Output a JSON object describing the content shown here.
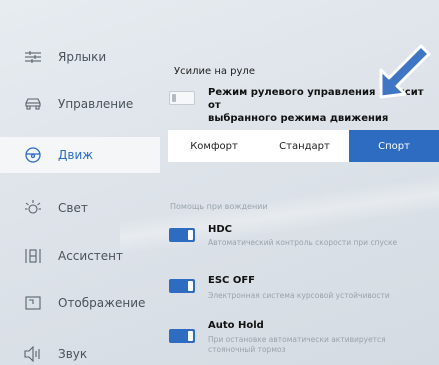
{
  "sidebar": {
    "items": [
      {
        "label": "Ярлыки",
        "icon": "shortcuts-icon"
      },
      {
        "label": "Управление",
        "icon": "car-icon"
      },
      {
        "label": "Движ",
        "icon": "steering-wheel-icon",
        "active": true
      },
      {
        "label": "Свет",
        "icon": "light-icon"
      },
      {
        "label": "Ассистент",
        "icon": "assistant-icon"
      },
      {
        "label": "Отображение",
        "icon": "display-icon"
      },
      {
        "label": "Звук",
        "icon": "speaker-icon"
      }
    ]
  },
  "steering": {
    "title": "Усилие на руле",
    "option_text_line1": "Режим рулевого управления зависит от",
    "option_text_line2": "выбранного режима движения",
    "option_enabled": false,
    "modes": [
      "Комфорт",
      "Стандарт",
      "Спорт"
    ],
    "selected_mode": "Спорт"
  },
  "assist": {
    "label": "Помощь при вождении",
    "features": [
      {
        "title": "HDC",
        "desc_line1": "Автоматический контроль скорости при спуске",
        "desc_line2": "",
        "enabled": true
      },
      {
        "title": "ESC OFF",
        "desc_line1": "Электронная система курсовой устойчивости",
        "desc_line2": "",
        "enabled": true
      },
      {
        "title": "Auto Hold",
        "desc_line1": "При остановке автоматически активируется",
        "desc_line2": "стояночный тормоз",
        "enabled": true
      }
    ]
  },
  "colors": {
    "accent": "#2d6cc0",
    "background": "#dde3e9",
    "arrow": "#3e76c4"
  }
}
